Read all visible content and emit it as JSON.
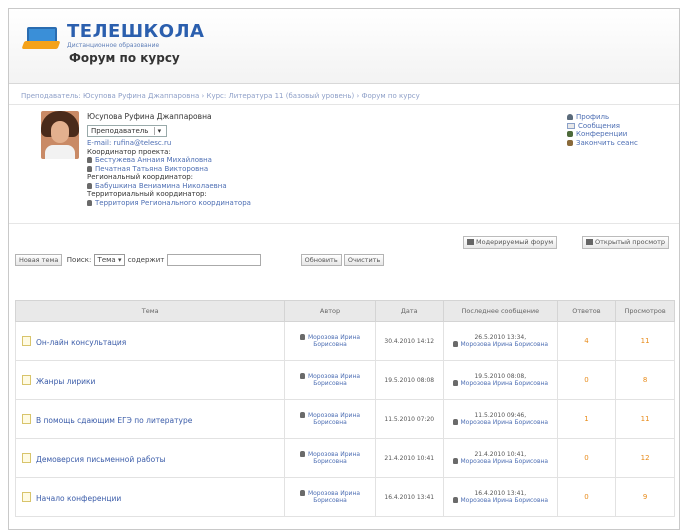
{
  "header": {
    "logo_text": "ТЕЛЕШКОЛА",
    "logo_sub": "Дистанционное образование",
    "page_title": "Форум по курсу"
  },
  "breadcrumb": "Преподаватель: Юсупова Руфина Джаппаровна › Курс: Литература 11 (базовый уровень) › Форум по курсу",
  "profile": {
    "name": "Юсупова Руфина Джаппаровна",
    "role": "Преподаватель",
    "email": "E-mail: rufina@telesc.ru",
    "coord_project_label": "Координатор проекта:",
    "coord_project": [
      "Бестужева Аннаия Михайловна",
      "Печатная Татьяна Викторовна"
    ],
    "coord_regional_label": "Региональный координатор:",
    "coord_regional": "Бабушкина Вениамина Николаевна",
    "coord_territorial_label": "Территориальный координатор:",
    "coord_territorial": "Территория Регионального координатора"
  },
  "right_menu": [
    "Профиль",
    "Сообщения",
    "Конференции",
    "Закончить сеанс"
  ],
  "toolbar": {
    "moderated_forum": "Модерируемый форум",
    "open_forum": "Открытый просмотр"
  },
  "filters": {
    "new_topic": "Новая тема",
    "search_label": "Поиск:",
    "field_value": "Тема",
    "contains": "содержит",
    "refresh": "Обновить",
    "clear": "Очистить"
  },
  "table": {
    "headers": [
      "Тема",
      "Автор",
      "Дата",
      "Последнее сообщение",
      "Ответов",
      "Просмотров"
    ],
    "rows": [
      {
        "title": "Он-лайн консультация",
        "author": "Морозова Ирина Борисовна",
        "date": "30.4.2010 14:12",
        "last_date": "26.5.2010 13:34,",
        "last_author": "Морозова Ирина Борисовна",
        "replies": "4",
        "views": "11"
      },
      {
        "title": "Жанры лирики",
        "author": "Морозова Ирина Борисовна",
        "date": "19.5.2010 08:08",
        "last_date": "19.5.2010 08:08,",
        "last_author": "Морозова Ирина Борисовна",
        "replies": "0",
        "views": "8"
      },
      {
        "title": "В помощь сдающим ЕГЭ по литературе",
        "author": "Морозова Ирина Борисовна",
        "date": "11.5.2010 07:20",
        "last_date": "11.5.2010 09:46,",
        "last_author": "Морозова Ирина Борисовна",
        "replies": "1",
        "views": "11"
      },
      {
        "title": "Демоверсия письменной работы",
        "author": "Морозова Ирина Борисовна",
        "date": "21.4.2010 10:41",
        "last_date": "21.4.2010 10:41,",
        "last_author": "Морозова Ирина Борисовна",
        "replies": "0",
        "views": "12"
      },
      {
        "title": "Начало конференции",
        "author": "Морозова Ирина Борисовна",
        "date": "16.4.2010 13:41",
        "last_date": "16.4.2010 13:41,",
        "last_author": "Морозова Ирина Борисовна",
        "replies": "0",
        "views": "9"
      }
    ]
  }
}
